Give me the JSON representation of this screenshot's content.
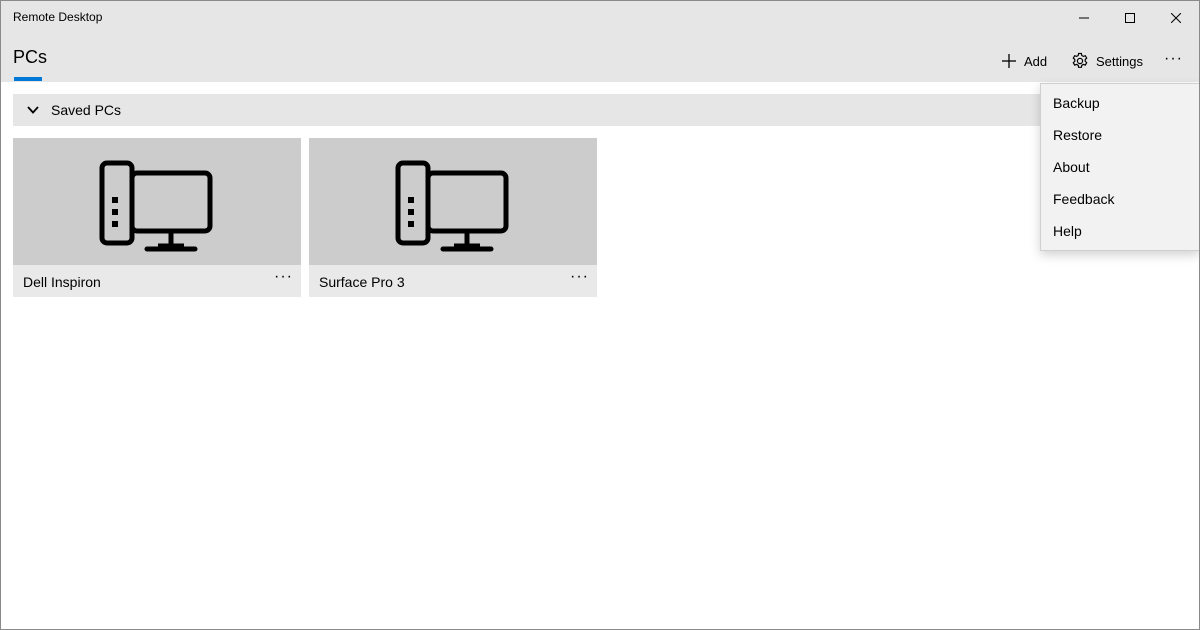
{
  "window": {
    "title": "Remote Desktop"
  },
  "header": {
    "tab_label": "PCs",
    "add_label": "Add",
    "settings_label": "Settings",
    "more_label": "···",
    "accent_color": "#0078d7"
  },
  "group": {
    "label": "Saved PCs"
  },
  "pcs": [
    {
      "name": "Dell Inspiron",
      "more_label": "···",
      "icon": "desktop-pc-icon"
    },
    {
      "name": "Surface Pro 3",
      "more_label": "···",
      "icon": "desktop-pc-icon"
    }
  ],
  "menu": {
    "items": [
      {
        "label": "Backup"
      },
      {
        "label": "Restore"
      },
      {
        "label": "About"
      },
      {
        "label": "Feedback"
      },
      {
        "label": "Help"
      }
    ]
  },
  "icons": {
    "minimize": "minimize-icon",
    "maximize": "maximize-icon",
    "close": "close-icon",
    "add": "plus-icon",
    "settings": "gear-icon",
    "collapse": "chevron-down-icon"
  }
}
